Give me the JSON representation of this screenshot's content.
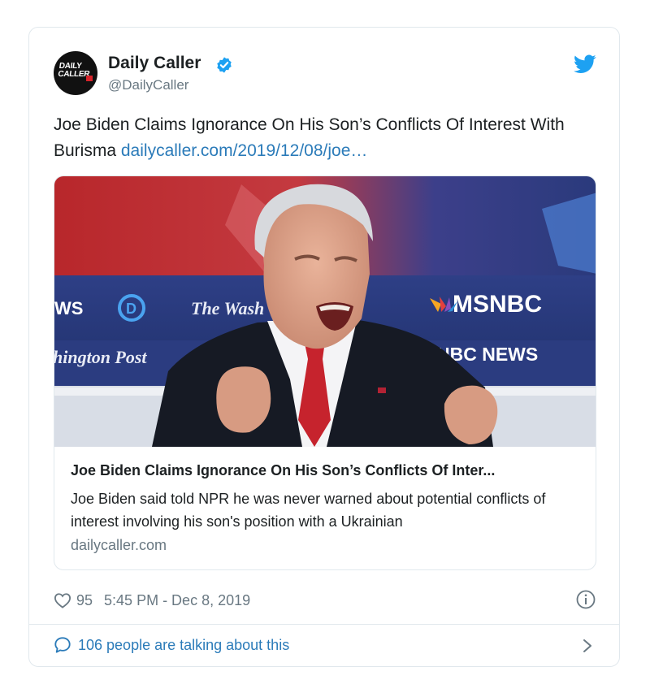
{
  "author": {
    "name": "Daily Caller",
    "handle": "@DailyCaller",
    "avatar_text": "DAILY CALLER"
  },
  "tweet": {
    "text": "Joe Biden Claims Ignorance On His Son’s Conflicts Of Interest With Burisma",
    "link": "dailycaller.com/2019/12/08/joe…"
  },
  "link_card": {
    "image_text": {
      "left_top": "WS",
      "washington_post_1": "The Wash",
      "washington_post_2": "hington Post",
      "msnbc": "MSNBC",
      "nbc_news": "NBC NEWS"
    },
    "title": "Joe Biden Claims Ignorance On His Son’s Conflicts Of Inter...",
    "description": "Joe Biden said told NPR he was never warned about potential conflicts of interest involving his son's position with a Ukrainian",
    "domain": "dailycaller.com"
  },
  "footer": {
    "likes": "95",
    "timestamp": "5:45 PM - Dec 8, 2019",
    "conversation": "106 people are talking about this"
  },
  "colors": {
    "link": "#2b7bb9",
    "twitter_blue": "#1da1f2",
    "muted": "#697882"
  },
  "icons": [
    "verified-icon",
    "twitter-bird-icon",
    "heart-icon",
    "info-icon",
    "comment-bubble-icon",
    "chevron-right-icon"
  ]
}
